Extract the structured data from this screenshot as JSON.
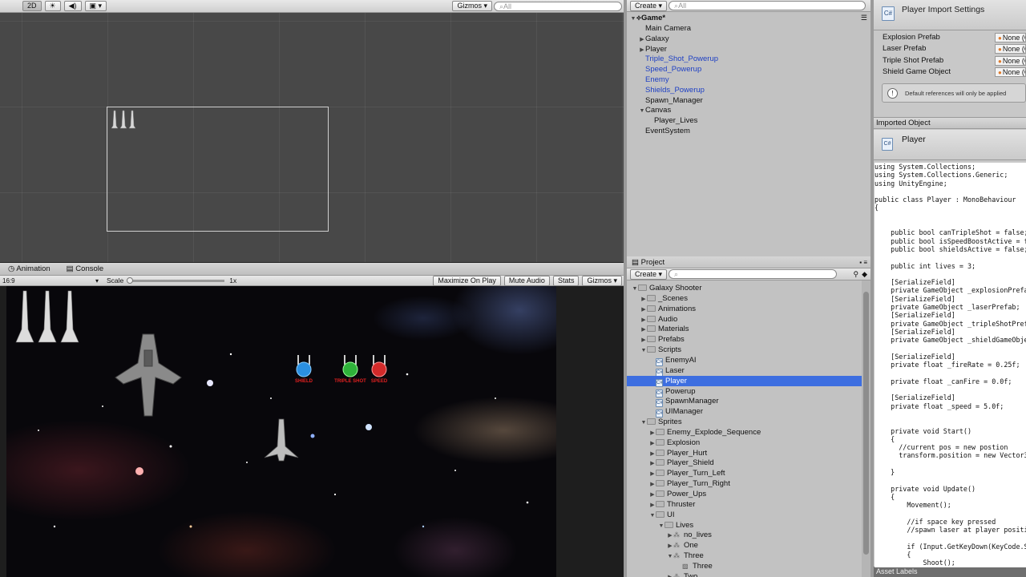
{
  "scene_toolbar": {
    "mode_2d": "2D",
    "gizmos": "Gizmos",
    "search": "All"
  },
  "hierarchy": {
    "create": "Create",
    "search": "All",
    "scene_name": "Game*",
    "items": [
      {
        "label": "Main Camera",
        "indent": 1,
        "arrow": "",
        "prefab": false
      },
      {
        "label": "Galaxy",
        "indent": 1,
        "arrow": "right",
        "prefab": false
      },
      {
        "label": "Player",
        "indent": 1,
        "arrow": "right",
        "prefab": false
      },
      {
        "label": "Triple_Shot_Powerup",
        "indent": 1,
        "arrow": "",
        "prefab": true
      },
      {
        "label": "Speed_Powerup",
        "indent": 1,
        "arrow": "",
        "prefab": true
      },
      {
        "label": "Enemy",
        "indent": 1,
        "arrow": "",
        "prefab": true
      },
      {
        "label": "Shields_Powerup",
        "indent": 1,
        "arrow": "",
        "prefab": true
      },
      {
        "label": "Spawn_Manager",
        "indent": 1,
        "arrow": "",
        "prefab": false
      },
      {
        "label": "Canvas",
        "indent": 1,
        "arrow": "down",
        "prefab": false
      },
      {
        "label": "Player_Lives",
        "indent": 2,
        "arrow": "",
        "prefab": false
      },
      {
        "label": "EventSystem",
        "indent": 1,
        "arrow": "",
        "prefab": false
      }
    ]
  },
  "bottom_tabs": {
    "animation": "Animation",
    "console": "Console"
  },
  "game_toolbar": {
    "aspect": "16:9",
    "scale_label": "Scale",
    "scale_value": "1x",
    "maximize": "Maximize On Play",
    "mute": "Mute Audio",
    "stats": "Stats",
    "gizmos": "Gizmos"
  },
  "game_view": {
    "powerup_labels": [
      "SHIELD",
      "TRIPLE SHOT",
      "SPEED"
    ]
  },
  "project": {
    "tab": "Project",
    "create": "Create",
    "items": [
      {
        "label": "Galaxy Shooter",
        "depth": 0,
        "arrow": "down",
        "type": "folder"
      },
      {
        "label": "_Scenes",
        "depth": 1,
        "arrow": "right",
        "type": "folder"
      },
      {
        "label": "Animations",
        "depth": 1,
        "arrow": "right",
        "type": "folder"
      },
      {
        "label": "Audio",
        "depth": 1,
        "arrow": "right",
        "type": "folder"
      },
      {
        "label": "Materials",
        "depth": 1,
        "arrow": "right",
        "type": "folder"
      },
      {
        "label": "Prefabs",
        "depth": 1,
        "arrow": "right",
        "type": "folder"
      },
      {
        "label": "Scripts",
        "depth": 1,
        "arrow": "down",
        "type": "folder"
      },
      {
        "label": "EnemyAI",
        "depth": 2,
        "arrow": "",
        "type": "script"
      },
      {
        "label": "Laser",
        "depth": 2,
        "arrow": "",
        "type": "script"
      },
      {
        "label": "Player",
        "depth": 2,
        "arrow": "",
        "type": "script",
        "selected": true
      },
      {
        "label": "Powerup",
        "depth": 2,
        "arrow": "",
        "type": "script"
      },
      {
        "label": "SpawnManager",
        "depth": 2,
        "arrow": "",
        "type": "script"
      },
      {
        "label": "UIManager",
        "depth": 2,
        "arrow": "",
        "type": "script"
      },
      {
        "label": "Sprites",
        "depth": 1,
        "arrow": "down",
        "type": "folder"
      },
      {
        "label": "Enemy_Explode_Sequence",
        "depth": 2,
        "arrow": "right",
        "type": "folder"
      },
      {
        "label": "Explosion",
        "depth": 2,
        "arrow": "right",
        "type": "folder"
      },
      {
        "label": "Player_Hurt",
        "depth": 2,
        "arrow": "right",
        "type": "folder"
      },
      {
        "label": "Player_Shield",
        "depth": 2,
        "arrow": "right",
        "type": "folder"
      },
      {
        "label": "Player_Turn_Left",
        "depth": 2,
        "arrow": "right",
        "type": "folder"
      },
      {
        "label": "Player_Turn_Right",
        "depth": 2,
        "arrow": "right",
        "type": "folder"
      },
      {
        "label": "Power_Ups",
        "depth": 2,
        "arrow": "right",
        "type": "folder"
      },
      {
        "label": "Thruster",
        "depth": 2,
        "arrow": "right",
        "type": "folder"
      },
      {
        "label": "UI",
        "depth": 2,
        "arrow": "down",
        "type": "folder"
      },
      {
        "label": "Lives",
        "depth": 3,
        "arrow": "down",
        "type": "folder"
      },
      {
        "label": "no_lives",
        "depth": 4,
        "arrow": "right",
        "type": "sprite"
      },
      {
        "label": "One",
        "depth": 4,
        "arrow": "right",
        "type": "sprite"
      },
      {
        "label": "Three",
        "depth": 4,
        "arrow": "down",
        "type": "sprite"
      },
      {
        "label": "Three",
        "depth": 5,
        "arrow": "",
        "type": "sprite-child"
      },
      {
        "label": "Two",
        "depth": 4,
        "arrow": "right",
        "type": "sprite"
      }
    ]
  },
  "inspector": {
    "title": "Player Import Settings",
    "fields": [
      {
        "label": "Explosion Prefab",
        "value": "None (G"
      },
      {
        "label": "Laser Prefab",
        "value": "None (G"
      },
      {
        "label": "Triple Shot Prefab",
        "value": "None (G"
      },
      {
        "label": "Shield Game Object",
        "value": "None (G"
      }
    ],
    "info": "Default references will only be applied",
    "imported_header": "Imported Object",
    "imported_name": "Player",
    "code": "using System.Collections;\nusing System.Collections.Generic;\nusing UnityEngine;\n\npublic class Player : MonoBehaviour\n{\n\n\n    public bool canTripleShot = false;\n    public bool isSpeedBoostActive = false;\n    public bool shieldsActive = false;\n\n    public int lives = 3;\n\n    [SerializeField]\n    private GameObject _explosionPrefab;\n    [SerializeField]\n    private GameObject _laserPrefab;\n    [SerializeField]\n    private GameObject _tripleShotPrefab;\n    [SerializeField]\n    private GameObject _shieldGameObject;\n\n    [SerializeField]\n    private float _fireRate = 0.25f;\n\n    private float _canFire = 0.0f;\n\n    [SerializeField]\n    private float _speed = 5.0f;\n\n\n    private void Start()\n    {\n      //current pos = new postion\n      transform.position = new Vector3(0\n\n    }\n\n    private void Update()\n    {\n        Movement();\n\n        //if space key pressed\n        //spawn laser at player position\n\n        if (Input.GetKeyDown(KeyCode.Spa\n        {\n            Shoot();",
    "asset_labels": "Asset Labels"
  }
}
